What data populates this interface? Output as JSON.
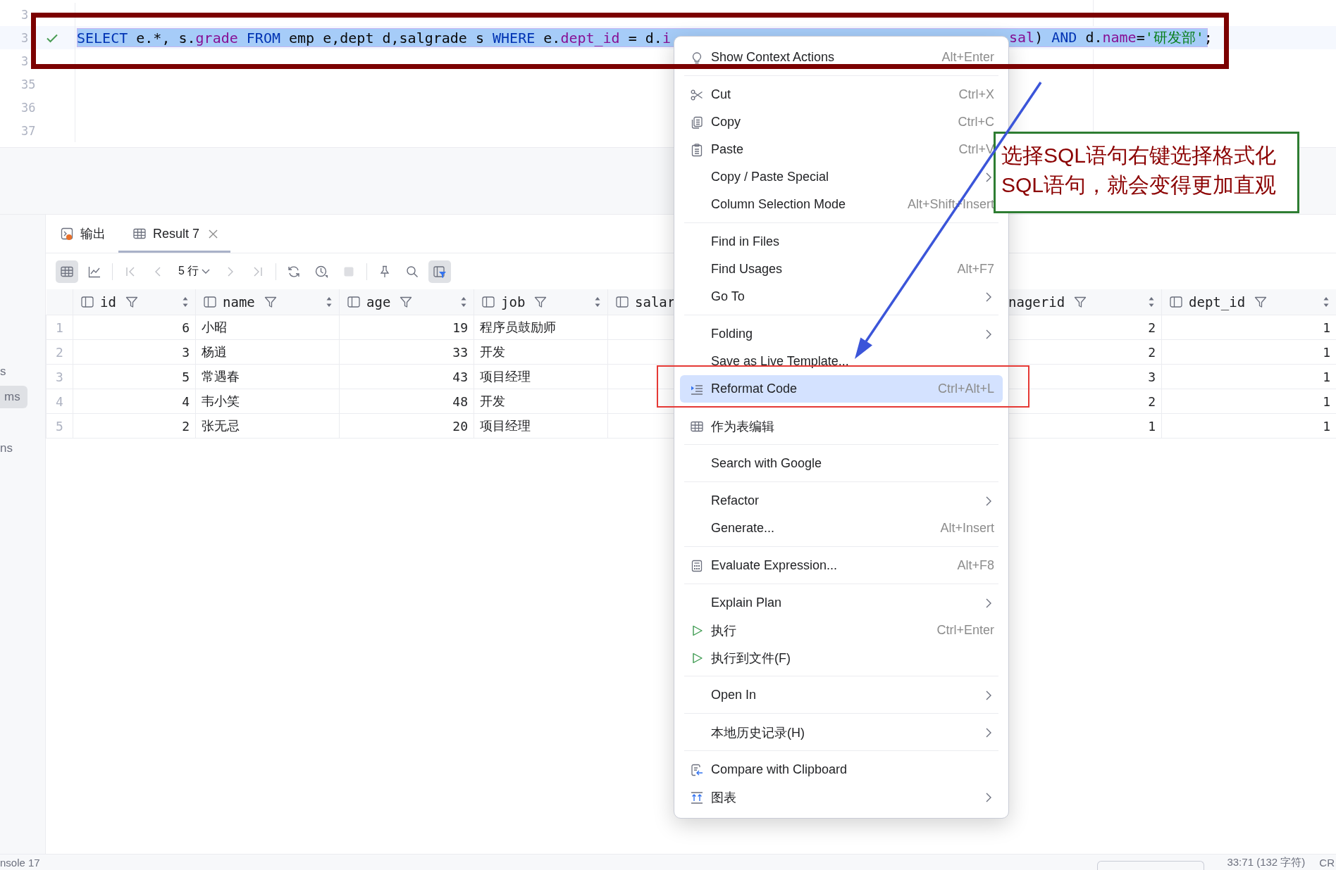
{
  "editor": {
    "lines": [
      {
        "number": "3",
        "current": false,
        "check": false
      },
      {
        "number": "3",
        "current": true,
        "check": true,
        "code": {
          "selected": true,
          "left": [
            {
              "kind": "keyword",
              "text": "SELECT"
            },
            {
              "kind": "plain",
              "text": " e.*, s."
            },
            {
              "kind": "field",
              "text": "grade "
            },
            {
              "kind": "keyword",
              "text": "FROM"
            },
            {
              "kind": "plain",
              "text": " emp e,dept d,salgrade s "
            },
            {
              "kind": "keyword",
              "text": "WHERE"
            },
            {
              "kind": "plain",
              "text": " e."
            },
            {
              "kind": "field",
              "text": "dept_id"
            },
            {
              "kind": "plain",
              "text": " = d."
            },
            {
              "kind": "field",
              "text": "i"
            }
          ],
          "right": [
            {
              "kind": "field",
              "text": "sal"
            },
            {
              "kind": "plain",
              "text": ") "
            },
            {
              "kind": "keyword",
              "text": "AND"
            },
            {
              "kind": "plain",
              "text": " d."
            },
            {
              "kind": "field",
              "text": "name"
            },
            {
              "kind": "plain",
              "text": "="
            },
            {
              "kind": "string",
              "text": "'研发部'"
            },
            {
              "kind": "plain",
              "text": ";"
            }
          ]
        }
      },
      {
        "number": "3",
        "current": false,
        "check": false
      },
      {
        "number": "35",
        "current": false,
        "check": false
      },
      {
        "number": "36",
        "current": false,
        "check": false
      },
      {
        "number": "37",
        "current": false,
        "check": false
      }
    ]
  },
  "side_strip": [
    {
      "kind": "plain",
      "text": "s"
    },
    {
      "kind": "chip",
      "text": "ms"
    },
    {
      "kind": "plain",
      "text": "ns"
    }
  ],
  "tabs": [
    {
      "label": "输出",
      "selected": false,
      "closable": false
    },
    {
      "label": "Result 7",
      "selected": true,
      "closable": true
    }
  ],
  "toolbar": [
    {
      "kind": "button",
      "selected": true,
      "disabled": false
    },
    {
      "kind": "button",
      "selected": false,
      "disabled": false
    },
    {
      "kind": "separator"
    },
    {
      "kind": "button",
      "selected": false,
      "disabled": true
    },
    {
      "kind": "button",
      "selected": false,
      "disabled": true
    },
    {
      "kind": "dropdown",
      "label": "5 行"
    },
    {
      "kind": "button",
      "selected": false,
      "disabled": true
    },
    {
      "kind": "button",
      "selected": false,
      "disabled": true
    },
    {
      "kind": "separator"
    },
    {
      "kind": "button",
      "selected": false,
      "disabled": false
    },
    {
      "kind": "button",
      "selected": false,
      "disabled": false
    },
    {
      "kind": "button",
      "selected": false,
      "disabled": true
    },
    {
      "kind": "separator"
    },
    {
      "kind": "button",
      "selected": false,
      "disabled": false
    },
    {
      "kind": "button",
      "selected": false,
      "disabled": false
    },
    {
      "kind": "button",
      "selected": true,
      "disabled": false
    }
  ],
  "table": {
    "columns": [
      {
        "name": "id",
        "kind": "full"
      },
      {
        "name": "name",
        "kind": "full"
      },
      {
        "name": "age",
        "kind": "full"
      },
      {
        "name": "job",
        "kind": "full"
      },
      {
        "name": "salar",
        "kind": "cut_right"
      },
      {
        "name": "nagerid",
        "kind": "cut_left"
      },
      {
        "name": "dept_id",
        "kind": "full"
      }
    ],
    "rows": [
      {
        "number": "1",
        "cells": [
          "6",
          "小昭",
          "19",
          "程序员鼓励师",
          "",
          "2",
          "1"
        ]
      },
      {
        "number": "2",
        "cells": [
          "3",
          "杨逍",
          "33",
          "开发",
          "",
          "2",
          "1"
        ]
      },
      {
        "number": "3",
        "cells": [
          "5",
          "常遇春",
          "43",
          "项目经理",
          "",
          "3",
          "1"
        ]
      },
      {
        "number": "4",
        "cells": [
          "4",
          "韦小笑",
          "48",
          "开发",
          "",
          "2",
          "1"
        ]
      },
      {
        "number": "5",
        "cells": [
          "2",
          "张无忌",
          "20",
          "项目经理",
          "",
          "1",
          "1"
        ]
      }
    ]
  },
  "context_menu": {
    "groups": [
      {
        "items": [
          {
            "label": "Show Context Actions",
            "shortcut": "Alt+Enter",
            "submenu": false,
            "selected": false
          }
        ]
      },
      {
        "items": [
          {
            "label": "Cut",
            "shortcut": "Ctrl+X",
            "submenu": false,
            "selected": false
          },
          {
            "label": "Copy",
            "shortcut": "Ctrl+C",
            "submenu": false,
            "selected": false
          },
          {
            "label": "Paste",
            "shortcut": "Ctrl+V",
            "submenu": false,
            "selected": false
          },
          {
            "label": "Copy / Paste Special",
            "submenu": true,
            "selected": false
          },
          {
            "label": "Column Selection Mode",
            "shortcut": "Alt+Shift+Insert",
            "submenu": false,
            "selected": false
          }
        ]
      },
      {
        "items": [
          {
            "label": "Find in Files",
            "submenu": false,
            "selected": false
          },
          {
            "label": "Find Usages",
            "shortcut": "Alt+F7",
            "submenu": false,
            "selected": false
          },
          {
            "label": "Go To",
            "submenu": true,
            "selected": false
          }
        ]
      },
      {
        "items": [
          {
            "label": "Folding",
            "submenu": true,
            "selected": false
          },
          {
            "label": "Save as Live Template...",
            "submenu": false,
            "selected": false
          },
          {
            "label": "Reformat Code",
            "shortcut": "Ctrl+Alt+L",
            "submenu": false,
            "selected": true
          }
        ]
      },
      {
        "items": [
          {
            "label": "作为表编辑",
            "submenu": false,
            "selected": false
          }
        ]
      },
      {
        "items": [
          {
            "label": "Search with Google",
            "submenu": false,
            "selected": false
          }
        ]
      },
      {
        "items": [
          {
            "label": "Refactor",
            "submenu": true,
            "selected": false
          },
          {
            "label": "Generate...",
            "shortcut": "Alt+Insert",
            "submenu": false,
            "selected": false
          }
        ]
      },
      {
        "items": [
          {
            "label": "Evaluate Expression...",
            "shortcut": "Alt+F8",
            "submenu": false,
            "selected": false
          }
        ]
      },
      {
        "items": [
          {
            "label": "Explain Plan",
            "submenu": true,
            "selected": false
          },
          {
            "label": "执行",
            "shortcut": "Ctrl+Enter",
            "submenu": false,
            "selected": false
          },
          {
            "label": "执行到文件(F)",
            "submenu": false,
            "selected": false
          }
        ]
      },
      {
        "items": [
          {
            "label": "Open In",
            "submenu": true,
            "selected": false
          }
        ]
      },
      {
        "items": [
          {
            "label": "本地历史记录(H)",
            "submenu": true,
            "selected": false
          }
        ]
      },
      {
        "items": [
          {
            "label": "Compare with Clipboard",
            "submenu": false,
            "selected": false
          },
          {
            "label": "图表",
            "submenu": true,
            "selected": false
          }
        ]
      }
    ]
  },
  "annotation": {
    "lines": [
      "选择SQL语句右键选择格式化",
      "SQL语句，就会变得更加直观"
    ]
  },
  "status_bar": {
    "left": "nsole 17",
    "position": "33:71 (132 字符)",
    "right": "CR"
  }
}
